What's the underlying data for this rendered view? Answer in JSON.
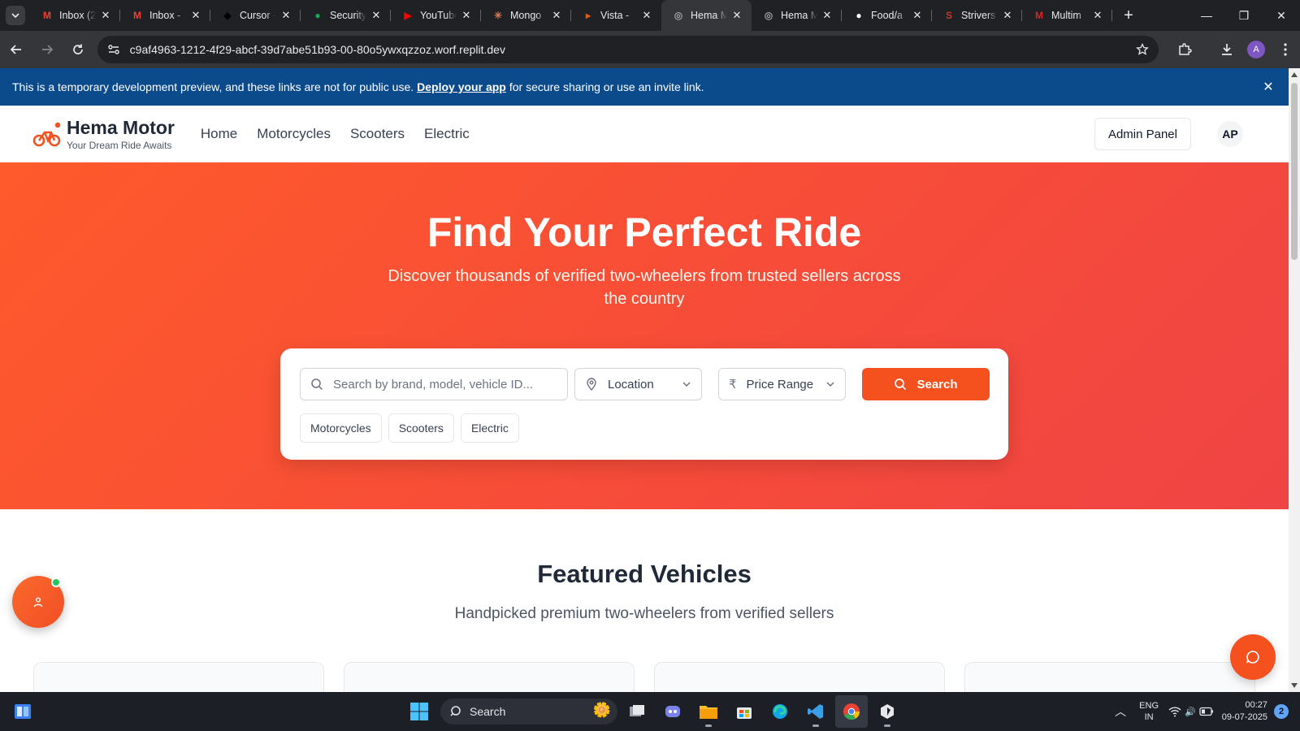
{
  "browser": {
    "tabs": [
      {
        "title": "Inbox (2",
        "icon": "gmail-icon",
        "color": "#EA4335",
        "glyph": "M"
      },
      {
        "title": "Inbox -",
        "icon": "gmail-icon",
        "color": "#EA4335",
        "glyph": "M"
      },
      {
        "title": "Cursor -",
        "icon": "cursor-icon",
        "color": "#000000",
        "glyph": "◆"
      },
      {
        "title": "Security",
        "icon": "mongodb-leaf-icon",
        "color": "#13AA52",
        "glyph": "●"
      },
      {
        "title": "YouTube",
        "icon": "youtube-icon",
        "color": "#FF0000",
        "glyph": "▶"
      },
      {
        "title": "Mongo",
        "icon": "claude-icon",
        "color": "#D97757",
        "glyph": "✳"
      },
      {
        "title": "Vista -",
        "icon": "vista-icon",
        "color": "#E8590C",
        "glyph": "▸"
      },
      {
        "title": "Hema M",
        "icon": "globe-icon",
        "color": "#9AA0A6",
        "glyph": "◎"
      },
      {
        "title": "Hema M",
        "icon": "globe-icon",
        "color": "#9AA0A6",
        "glyph": "◎"
      },
      {
        "title": "Food/a",
        "icon": "github-icon",
        "color": "#FFFFFF",
        "glyph": "●"
      },
      {
        "title": "Strivers",
        "icon": "striver-icon",
        "color": "#C0392B",
        "glyph": "S"
      },
      {
        "title": "Multim",
        "icon": "mdn-icon",
        "color": "#D62828",
        "glyph": "M"
      }
    ],
    "active_tab_index": 7,
    "url": "c9af4963-1212-4f29-abcf-39d7abe51b93-00-80o5ywxqzzoz.worf.replit.dev",
    "profile_initial": "A"
  },
  "banner": {
    "text_before": "This is a temporary development preview, and these links are not for public use.",
    "link": "Deploy your app",
    "text_after": "for secure sharing or use an invite link."
  },
  "site": {
    "brand": "Hema Motor",
    "tagline": "Your Dream Ride Awaits",
    "nav": [
      "Home",
      "Motorcycles",
      "Scooters",
      "Electric"
    ],
    "admin_label": "Admin Panel",
    "avatar_initials": "AP",
    "accent_color": "#F4511E"
  },
  "hero": {
    "title": "Find Your Perfect Ride",
    "subtitle": "Discover thousands of verified two-wheelers from trusted sellers across the country",
    "search_placeholder": "Search by brand, model, vehicle ID...",
    "location_label": "Location",
    "price_label": "Price Range",
    "search_button": "Search",
    "chips": [
      "Motorcycles",
      "Scooters",
      "Electric"
    ]
  },
  "featured": {
    "title": "Featured Vehicles",
    "subtitle": "Handpicked premium two-wheelers from verified sellers"
  },
  "taskbar": {
    "search_label": "Search",
    "lang_line1": "ENG",
    "lang_line2": "IN",
    "time": "00:27",
    "date": "09-07-2025",
    "notifications": "2"
  }
}
